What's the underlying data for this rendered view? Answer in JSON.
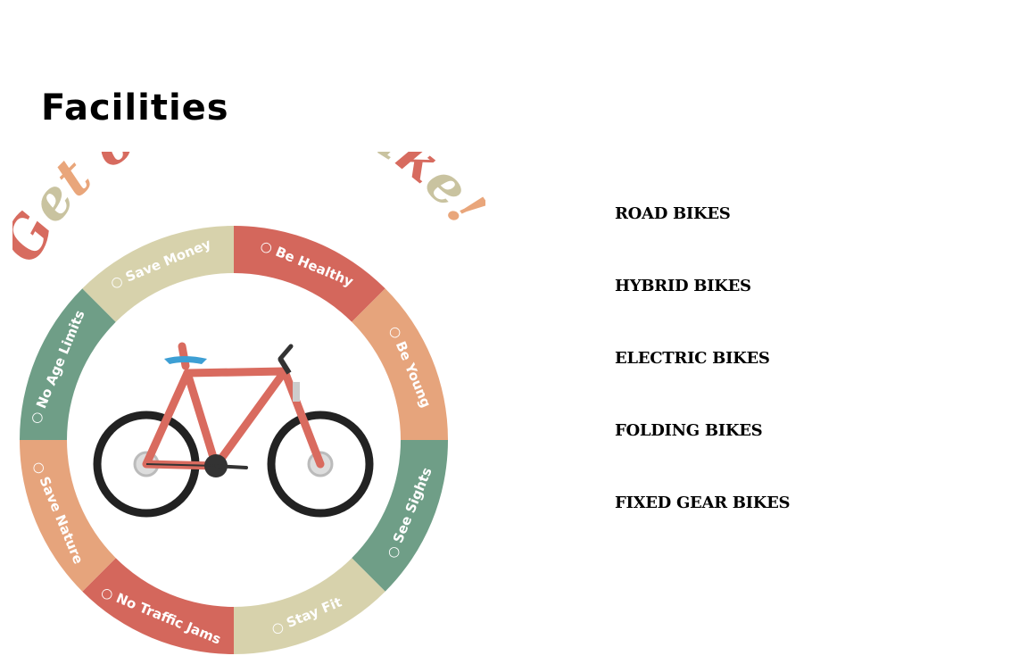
{
  "page": {
    "title": "Facilities"
  },
  "poster": {
    "headline": "Get on your bike!",
    "headline_colors": [
      "#d76b5f",
      "#c9c3a0",
      "#e9a67b",
      "#6f9e87",
      "#d76b5f",
      "#e9a67b",
      "#c9c3a0"
    ],
    "segments": [
      {
        "label": "Be Healthy",
        "icon": "heart-icon",
        "color": "#d4675c"
      },
      {
        "label": "Be Young",
        "icon": "leaf-icon",
        "color": "#e6a47c"
      },
      {
        "label": "See Sights",
        "icon": "camera-icon",
        "color": "#6f9e87"
      },
      {
        "label": "Stay Fit",
        "icon": "helmet-icon",
        "color": "#d7d2ac"
      },
      {
        "label": "No Traffic Jams",
        "icon": "butterfly-icon",
        "color": "#d4675c"
      },
      {
        "label": "Save Nature",
        "icon": "globe-icon",
        "color": "#e6a47c"
      },
      {
        "label": "No Age Limits",
        "icon": "people-icon",
        "color": "#6f9e87"
      },
      {
        "label": "Save Money",
        "icon": "dollar-icon",
        "color": "#d7d2ac"
      }
    ],
    "bike_colors": {
      "frame": "#d96b5f",
      "saddle": "#3d9fd4",
      "tire": "#222222"
    }
  },
  "bike_types": [
    {
      "label": "ROAD BIKES"
    },
    {
      "label": "HYBRID BIKES"
    },
    {
      "label": "ELECTRIC BIKES"
    },
    {
      "label": "FOLDING BIKES"
    },
    {
      "label": "FIXED GEAR BIKES"
    }
  ]
}
